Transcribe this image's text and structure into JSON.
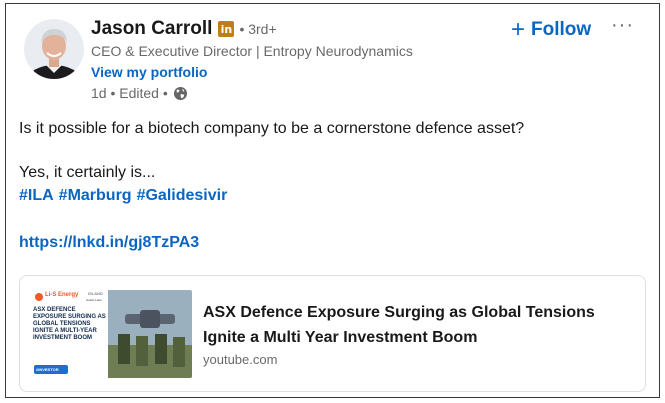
{
  "author": {
    "name": "Jason Carroll",
    "badge": "in",
    "degree": "• 3rd+",
    "headline": "CEO & Executive Director | Entropy Neurodynamics",
    "portfolio_label": "View my portfolio",
    "meta_time": "1d • Edited •",
    "visibility_icon": "globe-icon"
  },
  "actions": {
    "follow_label": "Follow",
    "follow_icon": "+",
    "more_label": "···"
  },
  "post": {
    "line1": "Is it possible for a biotech company to be a cornerstone defence asset?",
    "line2": "Yes, it certainly is...",
    "hashtags": [
      "#ILA",
      "#Marburg",
      "#Galidesivir"
    ],
    "link": "https://lnkd.in/gj8TzPA3"
  },
  "preview": {
    "title": "ASX Defence Exposure Surging as Global Tensions Ignite a Multi Year Investment Boom",
    "source": "youtube.com",
    "thumb_brand": "Li-S Energy",
    "thumb_brand2": "ISLAND",
    "thumb_brand3": "Austin Lane",
    "thumb_headline": "ASX DEFENCE EXPOSURE SURGING AS GLOBAL TENSIONS IGNITE A MULTI-YEAR INVESTMENT BOOM",
    "thumb_tag": "#INVESTOR"
  },
  "colors": {
    "link_blue": "#0a66c2",
    "badge_gold": "#c37d16",
    "muted": "rgba(0,0,0,0.6)"
  }
}
